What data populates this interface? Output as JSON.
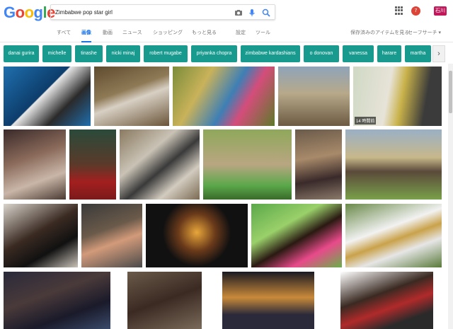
{
  "logo": [
    "G",
    "o",
    "o",
    "g",
    "l",
    "e"
  ],
  "logo_colors": [
    "#4285f4",
    "#ea4335",
    "#fbbc05",
    "#4285f4",
    "#34a853",
    "#ea4335"
  ],
  "search": {
    "query": "Zimbabwe pop star girl"
  },
  "header": {
    "notif_count": "7",
    "avatar": "石川"
  },
  "nav": {
    "all": "すべて",
    "images": "画像",
    "videos": "動画",
    "news": "ニュース",
    "shopping": "ショッピング",
    "more": "もっと見る",
    "settings": "設定",
    "tools": "ツール",
    "saved": "保存済みのアイテムを見る",
    "safesearch": "セーフサーチ ▾"
  },
  "chips": [
    "danai gurira",
    "michelle",
    "tinashe",
    "nicki minaj",
    "robert mugabe",
    "priyanka chopra",
    "zimbabwe kardashians",
    "o donovan",
    "vanessa",
    "harare",
    "martha"
  ],
  "chip_arrow": "›",
  "result_badge": "14 時間前",
  "colors": {
    "chip": "#189a8f",
    "accent": "#1a73e8"
  }
}
